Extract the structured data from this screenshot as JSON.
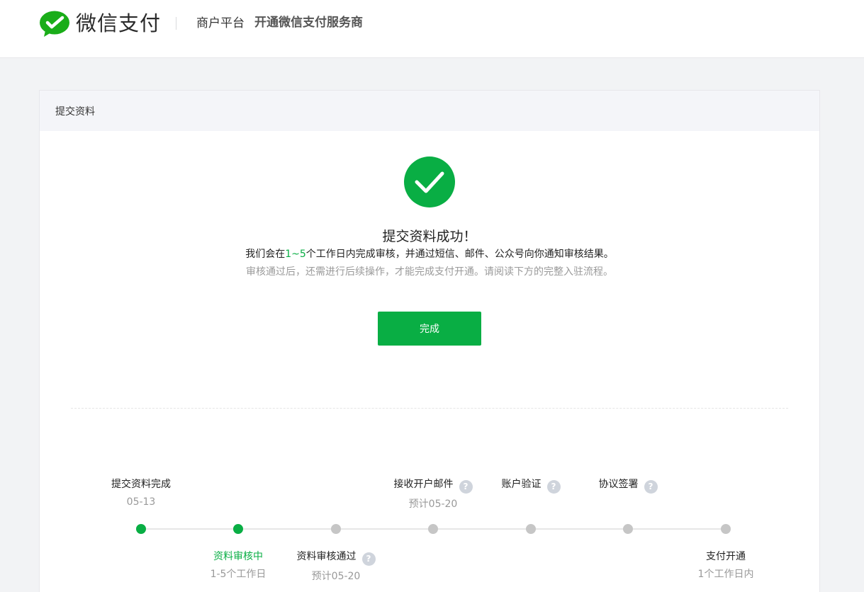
{
  "header": {
    "brand": "微信支付",
    "platform": "商户平台",
    "subtitle": "开通微信支付服务商"
  },
  "card": {
    "title": "提交资料",
    "success_title": "提交资料成功！",
    "notice_prefix": "我们会在",
    "notice_highlight": "1~5",
    "notice_suffix": "个工作日内完成审核，并通过短信、邮件、公众号向你通知审核结果。",
    "hint": "审核通过后，还需进行后续操作，才能完成支付开通。请阅读下方的完整入驻流程。",
    "done_button": "完成"
  },
  "timeline": {
    "help_glyph": "?",
    "steps": [
      {
        "label": "提交资料完成",
        "sub": "05-13",
        "status": "done"
      },
      {
        "label": "资料审核中",
        "sub": "1-5个工作日",
        "status": "current"
      },
      {
        "label": "资料审核通过",
        "sub": "预计05-20",
        "status": "pending"
      },
      {
        "label": "接收开户邮件",
        "sub": "预计05-20",
        "status": "pending"
      },
      {
        "label": "账户验证",
        "sub": "",
        "status": "pending"
      },
      {
        "label": "协议签署",
        "sub": "",
        "status": "pending"
      },
      {
        "label": "支付开通",
        "sub": "1个工作日内",
        "status": "pending"
      }
    ]
  },
  "colors": {
    "accent": "#09ae44",
    "pending_dot": "#c6c6c6",
    "help_icon": "#cfd4dc"
  }
}
